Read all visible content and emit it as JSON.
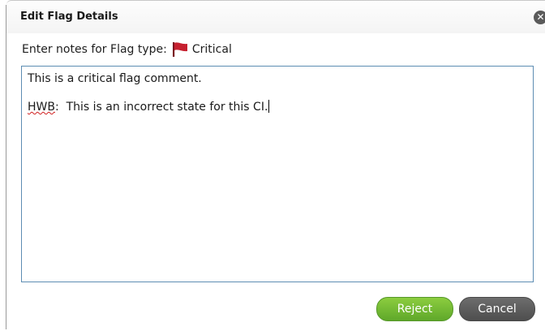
{
  "dialog": {
    "title": "Edit Flag Details",
    "close_icon": "close-icon"
  },
  "prompt": {
    "label": "Enter notes for Flag type:",
    "flag_icon": "red-flag-icon",
    "flag_color": "#c6202f",
    "flag_type": "Critical"
  },
  "notes": {
    "line1": "This is a critical flag comment.",
    "line2_prefix": "HWB",
    "line2_rest": ":  This is an incorrect state for this CI."
  },
  "buttons": {
    "reject_label": "Reject",
    "cancel_label": "Cancel"
  },
  "colors": {
    "reject_green": "#6fba33",
    "cancel_gray": "#5a5a5a",
    "textarea_border": "#5d8db3"
  }
}
